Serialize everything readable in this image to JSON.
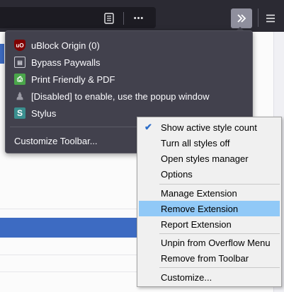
{
  "toolbar": {
    "overflow_icon": "chevrons-right-icon",
    "menu_icon": "hamburger-icon",
    "more_label": "•••"
  },
  "overflow_panel": {
    "items": [
      {
        "label": "uBlock Origin (0)",
        "icon": "ublock-icon"
      },
      {
        "label": "Bypass Paywalls",
        "icon": "bypass-paywalls-icon"
      },
      {
        "label": "Print Friendly & PDF",
        "icon": "print-friendly-icon"
      },
      {
        "label": "[Disabled] to enable, use the popup window",
        "icon": "disabled-extension-icon"
      },
      {
        "label": "Stylus",
        "icon": "stylus-icon"
      }
    ],
    "customize_label": "Customize Toolbar..."
  },
  "context_menu": {
    "items": [
      {
        "label": "Show active style count",
        "checked": true
      },
      {
        "label": "Turn all styles off"
      },
      {
        "label": "Open styles manager"
      },
      {
        "label": "Options"
      },
      {
        "label": "Manage Extension"
      },
      {
        "label": "Remove Extension",
        "highlighted": true
      },
      {
        "label": "Report Extension"
      },
      {
        "label": "Unpin from Overflow Menu"
      },
      {
        "label": "Remove from Toolbar"
      },
      {
        "label": "Customize..."
      }
    ]
  },
  "colors": {
    "toolbar_bg": "#2b2a33",
    "panel_bg": "#42414d",
    "menu_bg": "#f0f0f0",
    "menu_highlight": "#91c9f7",
    "page_accent": "#3d6bc2"
  }
}
